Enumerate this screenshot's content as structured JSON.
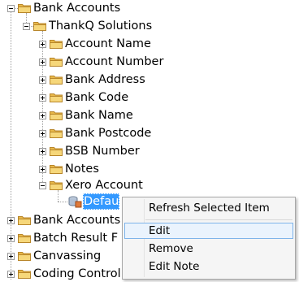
{
  "tree": {
    "root_label": "Bank Accounts",
    "org_label": "ThankQ Solutions",
    "fields": [
      "Account Name",
      "Account Number",
      "Bank Address",
      "Bank Code",
      "Bank Name",
      "Bank Postcode",
      "BSB Number",
      "Notes",
      "Xero Account"
    ],
    "selected_item": "Defau",
    "siblings": [
      "Bank Accounts",
      "Batch Result F",
      "Canvassing",
      "Coding Control"
    ]
  },
  "context_menu": {
    "refresh": "Refresh Selected Item",
    "edit": "Edit",
    "remove": "Remove",
    "edit_note": "Edit Note"
  },
  "colors": {
    "selection": "#3399ff",
    "menu_highlight": "#eaf3fd",
    "folder": "#f3d271"
  }
}
